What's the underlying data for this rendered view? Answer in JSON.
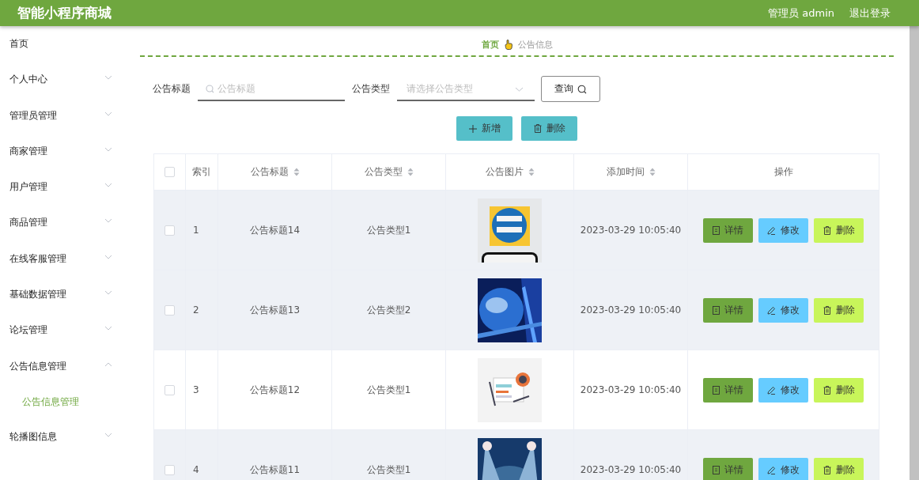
{
  "header": {
    "title": "智能小程序商城",
    "user": "管理员 admin",
    "logout": "退出登录"
  },
  "sidebar": {
    "items": [
      {
        "label": "首页",
        "kind": "link"
      },
      {
        "label": "个人中心",
        "kind": "menu",
        "expanded": false
      },
      {
        "label": "管理员管理",
        "kind": "menu",
        "expanded": false
      },
      {
        "label": "商家管理",
        "kind": "menu",
        "expanded": false
      },
      {
        "label": "用户管理",
        "kind": "menu",
        "expanded": false
      },
      {
        "label": "商品管理",
        "kind": "menu",
        "expanded": false
      },
      {
        "label": "在线客服管理",
        "kind": "menu",
        "expanded": false
      },
      {
        "label": "基础数据管理",
        "kind": "menu",
        "expanded": false
      },
      {
        "label": "论坛管理",
        "kind": "menu",
        "expanded": false
      },
      {
        "label": "公告信息管理",
        "kind": "menu",
        "expanded": true,
        "children": [
          {
            "label": "公告信息管理",
            "selected": true
          }
        ]
      },
      {
        "label": "轮播图信息",
        "kind": "menu",
        "expanded": false
      }
    ]
  },
  "breadcrumb": [
    {
      "label": "首页",
      "kind": "link"
    },
    {
      "label": "公告信息",
      "kind": "current"
    }
  ],
  "search": {
    "fields": [
      {
        "label": "公告标题",
        "placeholder": "公告标题",
        "kind": "text"
      },
      {
        "label": "公告类型",
        "placeholder": "请选择公告类型",
        "kind": "select"
      }
    ],
    "button": "查询"
  },
  "actions": [
    {
      "label": "新增",
      "kind": "add"
    },
    {
      "label": "删除",
      "kind": "delete"
    }
  ],
  "table": {
    "select_all": {
      "checked": false
    },
    "columns": [
      {
        "label": "索引",
        "sortable": false
      },
      {
        "label": "公告标题",
        "sortable": true
      },
      {
        "label": "公告类型",
        "sortable": true
      },
      {
        "label": "公告图片",
        "sortable": true
      },
      {
        "label": "添加时间",
        "sortable": true
      },
      {
        "label": "操作",
        "sortable": false
      }
    ],
    "rows": [
      {
        "checked": false,
        "shaded": true,
        "index": "1",
        "title": "公告标题14",
        "type": "公告类型1",
        "image": {
          "kind": "picture"
        },
        "added": "2023-03-29 10:05:40",
        "actions": [
          {
            "label": "详情",
            "kind": "detail"
          },
          {
            "label": "修改",
            "kind": "edit"
          },
          {
            "label": "删除",
            "kind": "delete"
          }
        ]
      },
      {
        "checked": false,
        "shaded": true,
        "index": "2",
        "title": "公告标题13",
        "type": "公告类型2",
        "image": {
          "kind": "picture"
        },
        "added": "2023-03-29 10:05:40",
        "actions": [
          {
            "label": "详情",
            "kind": "detail"
          },
          {
            "label": "修改",
            "kind": "edit"
          },
          {
            "label": "删除",
            "kind": "delete"
          }
        ]
      },
      {
        "checked": false,
        "shaded": false,
        "index": "3",
        "title": "公告标题12",
        "type": "公告类型1",
        "image": {
          "kind": "picture"
        },
        "added": "2023-03-29 10:05:40",
        "actions": [
          {
            "label": "详情",
            "kind": "detail"
          },
          {
            "label": "修改",
            "kind": "edit"
          },
          {
            "label": "删除",
            "kind": "delete"
          }
        ]
      },
      {
        "checked": false,
        "shaded": true,
        "index": "4",
        "title": "公告标题11",
        "type": "公告类型1",
        "image": {
          "kind": "picture"
        },
        "added": "2023-03-29 10:05:40",
        "actions": [
          {
            "label": "详情",
            "kind": "detail"
          },
          {
            "label": "修改",
            "kind": "edit"
          },
          {
            "label": "删除",
            "kind": "delete"
          }
        ]
      }
    ]
  }
}
